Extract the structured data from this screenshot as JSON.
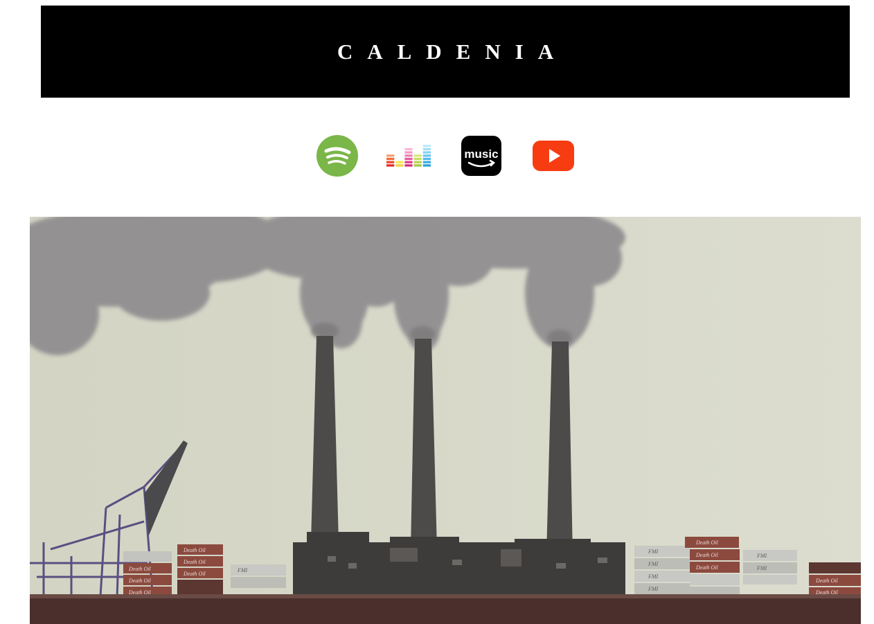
{
  "header": {
    "brand": "CALDENIA"
  },
  "streaming_links": [
    {
      "name": "spotify",
      "icon": "spotify-icon",
      "color": "#7ab648"
    },
    {
      "name": "deezer",
      "icon": "deezer-icon"
    },
    {
      "name": "amazon-music",
      "icon": "amazon-music-icon",
      "label": "music",
      "color": "#000000"
    },
    {
      "name": "youtube",
      "icon": "youtube-icon",
      "color": "#f83c12"
    }
  ],
  "hero": {
    "container_labels": [
      "Death Oil",
      "FMI"
    ]
  },
  "colors": {
    "banner": "#000000",
    "sky": "#d6d7c8",
    "smoke": "#8f8c8f",
    "stack": "#4d4b4a"
  }
}
